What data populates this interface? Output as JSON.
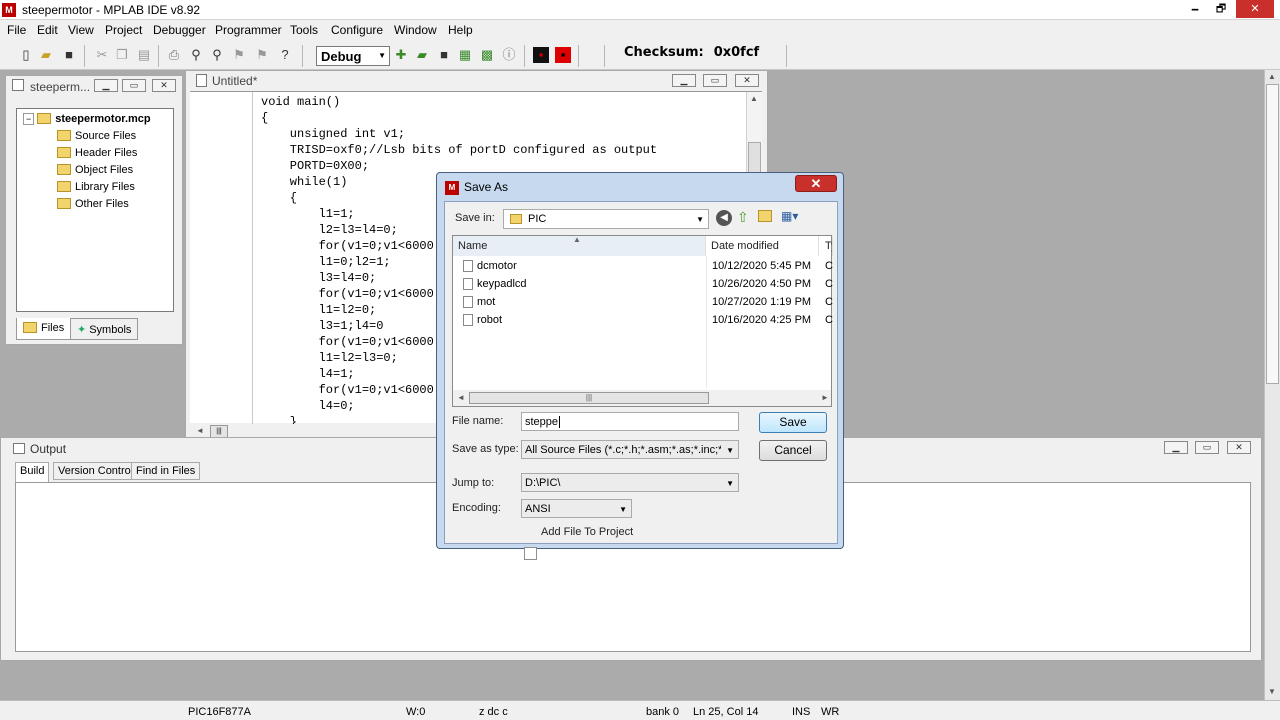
{
  "window": {
    "title": "steepermotor - MPLAB IDE v8.92",
    "icon": "mplab-icon"
  },
  "caption_buttons": {
    "minimize": "🗕",
    "maximize": "🗗",
    "close": "✕"
  },
  "menu": [
    "File",
    "Edit",
    "View",
    "Project",
    "Debugger",
    "Programmer",
    "Tools",
    "Configure",
    "Window",
    "Help"
  ],
  "toolbar": {
    "build_config": "Debug",
    "checksum_label": "Checksum:",
    "checksum_value": "0x0fcf"
  },
  "project_window": {
    "title": "steeperm...",
    "root": "steepermotor.mcp",
    "folders": [
      "Source Files",
      "Header Files",
      "Object Files",
      "Library Files",
      "Other Files"
    ],
    "tabs": [
      "Files",
      "Symbols"
    ]
  },
  "editor": {
    "title": "Untitled*",
    "lines": [
      "void main()",
      "{",
      "    unsigned int v1;",
      "    TRISD=oxf0;//Lsb bits of portD configured as output",
      "    PORTD=0X00;",
      "    while(1)",
      "    {",
      "        l1=1;",
      "        l2=l3=l4=0;",
      "        for(v1=0;v1<6000",
      "        l1=0;l2=1;",
      "        l3=l4=0;",
      "        for(v1=0;v1<6000",
      "        l1=l2=0;",
      "        l3=1;l4=0",
      "        for(v1=0;v1<6000",
      "        l1=l2=l3=0;",
      "        l4=1;",
      "        for(v1=0;v1<6000",
      "        l4=0;",
      "    }"
    ]
  },
  "output_window": {
    "title": "Output",
    "tabs": [
      "Build",
      "Version Control",
      "Find in Files"
    ]
  },
  "save_dialog": {
    "title": "Save As",
    "save_in_label": "Save in:",
    "save_in_value": "PIC",
    "columns": {
      "name": "Name",
      "date": "Date modified",
      "type": "Ty"
    },
    "files": [
      {
        "name": "dcmotor",
        "date": "10/12/2020 5:45 PM",
        "type": "C"
      },
      {
        "name": "keypadlcd",
        "date": "10/26/2020 4:50 PM",
        "type": "C"
      },
      {
        "name": "mot",
        "date": "10/27/2020 1:19 PM",
        "type": "C"
      },
      {
        "name": "robot",
        "date": "10/16/2020 4:25 PM",
        "type": "C"
      }
    ],
    "file_name_label": "File name:",
    "file_name_value": "steppe",
    "save_type_label": "Save as type:",
    "save_type_value": "All Source Files (*.c;*.h;*.asm;*.as;*.inc;*.s;*.b",
    "jump_to_label": "Jump to:",
    "jump_to_value": "D:\\PIC\\",
    "encoding_label": "Encoding:",
    "encoding_value": "ANSI",
    "add_to_project_label": "Add File To Project",
    "add_to_project_checked": false,
    "save_button": "Save",
    "cancel_button": "Cancel"
  },
  "statusbar": {
    "device": "PIC16F877A",
    "w_reg": "W:0",
    "flags": "z dc c",
    "bank": "bank 0",
    "position": "Ln 25, Col 14",
    "ins": "INS",
    "wr": "WR"
  }
}
